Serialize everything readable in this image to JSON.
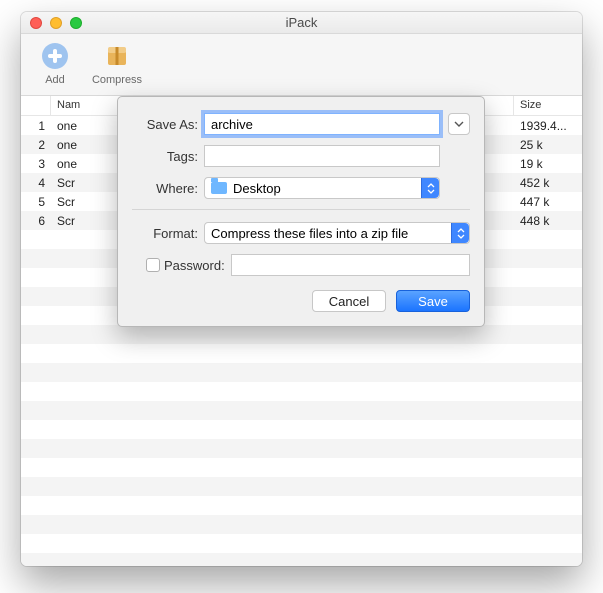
{
  "window": {
    "title": "iPack"
  },
  "toolbar": {
    "add_label": "Add",
    "compress_label": "Compress"
  },
  "table": {
    "headers": {
      "num": "",
      "name": "Nam",
      "size": "Size"
    },
    "rows": [
      {
        "num": "1",
        "name": "one",
        "size": "1939.4..."
      },
      {
        "num": "2",
        "name": "one",
        "size": "25 k"
      },
      {
        "num": "3",
        "name": "one",
        "size": "19 k"
      },
      {
        "num": "4",
        "name": "Scr",
        "size": "452 k"
      },
      {
        "num": "5",
        "name": "Scr",
        "size": "447 k"
      },
      {
        "num": "6",
        "name": "Scr",
        "size": "448 k"
      }
    ]
  },
  "dialog": {
    "save_as_label": "Save As:",
    "save_as_value": "archive",
    "tags_label": "Tags:",
    "tags_value": "",
    "where_label": "Where:",
    "where_value": "Desktop",
    "format_label": "Format:",
    "format_value": "Compress these files into a zip file",
    "password_label": "Password:",
    "password_value": "",
    "cancel_label": "Cancel",
    "save_label": "Save"
  }
}
